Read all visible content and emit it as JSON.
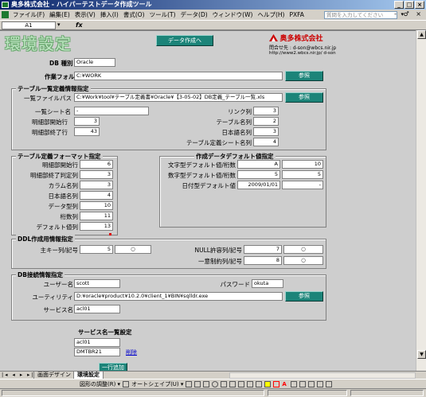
{
  "window": {
    "title": "奥多株式会社 - ハイパーテストデータ作成ツール",
    "controls": [
      "_",
      "□",
      "×"
    ]
  },
  "menu": {
    "items": [
      "ファイル(F)",
      "編集(E)",
      "表示(V)",
      "挿入(I)",
      "書式(O)",
      "ツール(T)",
      "データ(D)",
      "ウィンドウ(W)",
      "ヘルプ(H)",
      "PXFA"
    ],
    "help_placeholder": "質問を入力してください",
    "help_arrow": "▾",
    "doc_controls": "- ♂ ×"
  },
  "formula_bar": {
    "cell_ref": "A1",
    "cell_arrow": "▾",
    "fx": "fx"
  },
  "sheet": {
    "title": "環境設定",
    "create_button": "データ作成へ",
    "company": {
      "name": "奥多株式会社",
      "contact": "問合せ先 : d-son@wbcs.nir.jp",
      "url": "http://www2.wbcs.nir.jp/ d-son"
    },
    "db_type": {
      "label": "DB 種別",
      "value": "Oracle"
    },
    "work_folder": {
      "label": "作業フォルダ",
      "value": "C:¥WORK",
      "browse": "参照"
    },
    "table_list": {
      "title": "テーブル一覧定義情報指定",
      "file_label": "一覧ファイルパス",
      "file_value": "C:¥Work¥tool¥テーブル定義書¥Oracle¥【3-05-02】DB定義_テーブル一覧.xls",
      "browse": "参照",
      "sheet_label": "一覧シート名",
      "sheet_value": "-",
      "start_label": "明細部開始行",
      "start_value": "3",
      "end_label": "明細部終了行",
      "end_value": "43",
      "link_label": "リンク列",
      "link_value": "3",
      "table_col_label": "テーブル名列",
      "table_col_value": "2",
      "jp_col_label": "日本語名列",
      "jp_col_value": "3",
      "def_sheet_label": "テーブル定義シート名列",
      "def_sheet_value": "4"
    },
    "table_def": {
      "title": "テーブル定義フォーマット指定",
      "rows": [
        {
          "label": "明細部開始行",
          "value": "6"
        },
        {
          "label": "明細部終了判定列",
          "value": "3"
        },
        {
          "label": "カラム名列",
          "value": "3"
        },
        {
          "label": "日本語名列",
          "value": "4"
        },
        {
          "label": "データ型列",
          "value": "10"
        },
        {
          "label": "桁数列",
          "value": "11"
        },
        {
          "label": "デフォルト値列",
          "value": "13"
        }
      ]
    },
    "default_values": {
      "title": "作成データデフォルト値指定",
      "rows": [
        {
          "label": "文字型デフォルト値/桁数",
          "value1": "A",
          "value2": "10"
        },
        {
          "label": "数字型デフォルト値/桁数",
          "value1": "5",
          "value2": "5"
        },
        {
          "label": "日付型デフォルト値",
          "value1": "2009/01/01",
          "value2": "-"
        }
      ]
    },
    "ddl": {
      "title": "DDL作成用情報指定",
      "pk_label": "主キー列/記号",
      "pk_value": "5",
      "pk_symbol": "○",
      "null_label": "NULL許容列/記号",
      "null_value": "7",
      "null_symbol": "○",
      "unique_label": "一意制約列/記号",
      "unique_value": "8",
      "unique_symbol": "○"
    },
    "db_connect": {
      "title": "DB接続情報指定",
      "user_label": "ユーザー名",
      "user_value": "scott",
      "password_label": "パスワード",
      "password_value": "okuta",
      "utility_label": "ユーティリティ",
      "utility_value": "D:¥oracle¥product¥10.2.0¥client_1¥BIN¥sqlldr.exe",
      "browse": "参照",
      "service_label": "サービス名",
      "service_value": "acl01"
    },
    "services": {
      "title": "サービス名一覧設定",
      "items": [
        "acl01",
        "DMTBR21"
      ],
      "delete_link": "削除",
      "add_button": "一行追加"
    }
  },
  "tabs": {
    "nav": "|◂ ◂ ▸ ▸|",
    "items": [
      "画面デザイン",
      "環境設定"
    ],
    "active": "環境設定"
  },
  "drawbar": {
    "draw": "図形の調整(R) ▾",
    "autoshape": "オートシェイプ(U) ▾"
  }
}
